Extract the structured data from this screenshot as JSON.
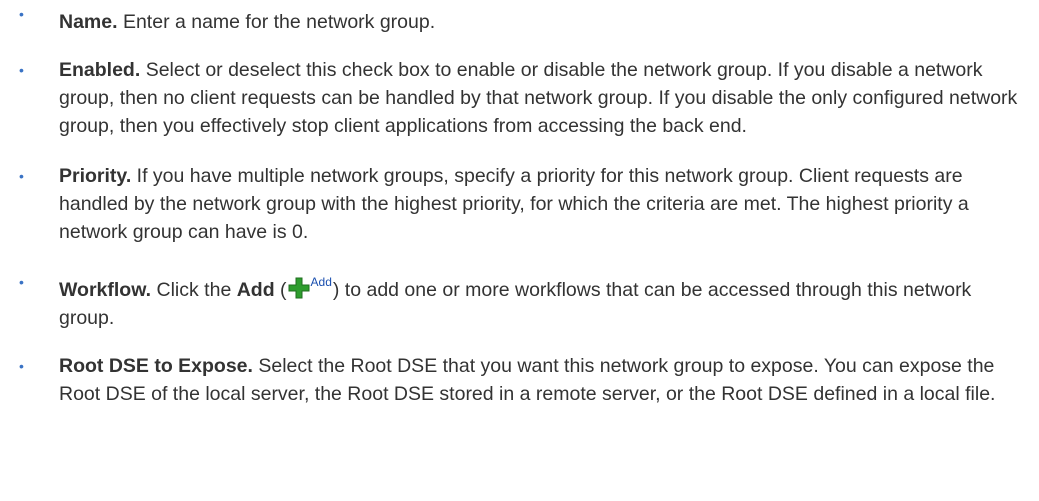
{
  "items": [
    {
      "term": "Name.",
      "text": " Enter a name for the network group."
    },
    {
      "term": "Enabled.",
      "text": " Select or deselect this check box to enable or disable the network group. If you disable a network group, then no client requests can be handled by that network group. If you disable the only configured network group, then you effectively stop client applications from accessing the back end."
    },
    {
      "term": "Priority.",
      "text": " If you have multiple network groups, specify a priority for this network group. Client requests are handled by the network group with the highest priority, for which the criteria are met. The highest priority a network group can have is 0."
    },
    {
      "term": "Workflow.",
      "text_before": " Click the ",
      "button_name": "Add",
      "open_paren": " (",
      "icon_label": "Add",
      "text_after": ") to add one or more workflows that can be accessed through this network group."
    },
    {
      "term": "Root DSE to Expose.",
      "text": " Select the Root DSE that you want this network group to expose. You can expose the Root DSE of the local server, the Root DSE stored in a remote server, or the Root DSE defined in a local file."
    }
  ],
  "bullet_char": "•",
  "icon": {
    "name": "plus-icon",
    "color": "#2e9d2e"
  }
}
